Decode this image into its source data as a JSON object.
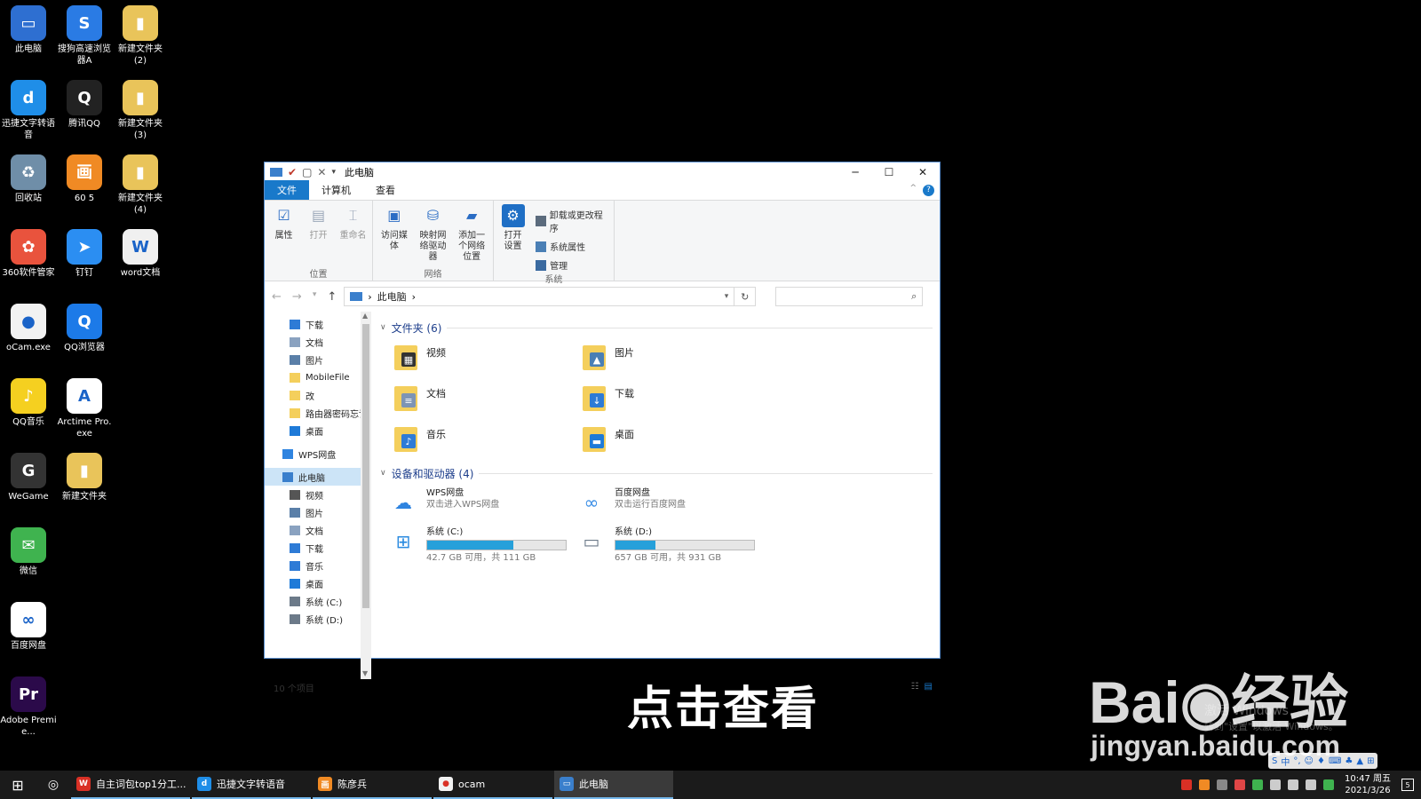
{
  "desktop_icons": [
    {
      "label": "此电脑",
      "color": "#2e6fd1",
      "glyph": "▭",
      "icon": "this-pc-icon"
    },
    {
      "label": "搜狗高速浏览器A",
      "color": "#2a7be4",
      "glyph": "S",
      "icon": "sogou-browser-icon"
    },
    {
      "label": "新建文件夹 (2)",
      "color": "#e9c45a",
      "glyph": "▮",
      "icon": "folder-icon"
    },
    {
      "label": "迅捷文字转语音",
      "color": "#1f8ee8",
      "glyph": "d",
      "icon": "tts-app-icon"
    },
    {
      "label": "腾讯QQ",
      "color": "#222222",
      "glyph": "Q",
      "icon": "qq-icon"
    },
    {
      "label": "新建文件夹 (3)",
      "color": "#e9c45a",
      "glyph": "▮",
      "icon": "folder-icon"
    },
    {
      "label": "回收站",
      "color": "#6f8ea8",
      "glyph": "♻",
      "icon": "recycle-bin-icon"
    },
    {
      "label": "60 5",
      "color": "#f08a24",
      "glyph": "画",
      "icon": "app-60-icon"
    },
    {
      "label": "新建文件夹 (4)",
      "color": "#e9c45a",
      "glyph": "▮",
      "icon": "folder-icon"
    },
    {
      "label": "360软件管家",
      "color": "#e9533d",
      "glyph": "✿",
      "icon": "360-manager-icon"
    },
    {
      "label": "钉钉",
      "color": "#2b8ef2",
      "glyph": "➤",
      "icon": "dingtalk-icon"
    },
    {
      "label": "word文档",
      "color": "#f0f0f0",
      "glyph": "W",
      "icon": "word-doc-icon"
    },
    {
      "label": "oCam.exe",
      "color": "#f2f2f2",
      "glyph": "●",
      "icon": "ocam-icon"
    },
    {
      "label": "QQ浏览器",
      "color": "#1c7ae8",
      "glyph": "Q",
      "icon": "qq-browser-icon"
    },
    {
      "label": "",
      "color": "#000000",
      "glyph": "",
      "icon": "empty-slot"
    },
    {
      "label": "QQ音乐",
      "color": "#f5d020",
      "glyph": "♪",
      "icon": "qq-music-icon"
    },
    {
      "label": "Arctime Pro.exe",
      "color": "#ffffff",
      "glyph": "A",
      "icon": "arctime-icon"
    },
    {
      "label": "",
      "color": "#000000",
      "glyph": "",
      "icon": "empty-slot"
    },
    {
      "label": "WeGame",
      "color": "#333333",
      "glyph": "G",
      "icon": "wegame-icon"
    },
    {
      "label": "新建文件夹",
      "color": "#e9c45a",
      "glyph": "▮",
      "icon": "folder-icon"
    },
    {
      "label": "",
      "color": "#000000",
      "glyph": "",
      "icon": "empty-slot"
    },
    {
      "label": "微信",
      "color": "#3fb34f",
      "glyph": "✉",
      "icon": "wechat-icon"
    },
    {
      "label": "",
      "color": "#000000",
      "glyph": "",
      "icon": "empty-slot"
    },
    {
      "label": "",
      "color": "#000000",
      "glyph": "",
      "icon": "empty-slot"
    },
    {
      "label": "百度网盘",
      "color": "#ffffff",
      "glyph": "∞",
      "icon": "baidu-netdisk-icon"
    },
    {
      "label": "",
      "color": "#000000",
      "glyph": "",
      "icon": "empty-slot"
    },
    {
      "label": "",
      "color": "#000000",
      "glyph": "",
      "icon": "empty-slot"
    },
    {
      "label": "Adobe Premie...",
      "color": "#2b0a4a",
      "glyph": "Pr",
      "icon": "premiere-icon"
    }
  ],
  "window": {
    "title": "此电脑",
    "minimize": "─",
    "maximize": "☐",
    "close": "✕",
    "qa_icons": [
      "✔",
      "▢",
      "✕",
      "▾"
    ]
  },
  "tabs": {
    "file": "文件",
    "computer": "计算机",
    "view": "查看",
    "help": "?",
    "collapse": "^"
  },
  "ribbon": {
    "location": {
      "name": "位置",
      "buttons": [
        {
          "label": "属性",
          "icon": "properties-icon",
          "glyph": "☑",
          "dim": false
        },
        {
          "label": "打开",
          "icon": "open-icon",
          "glyph": "▤",
          "dim": true
        },
        {
          "label": "重命名",
          "icon": "rename-icon",
          "glyph": "⌶",
          "dim": true
        }
      ]
    },
    "network": {
      "name": "网络",
      "buttons": [
        {
          "label": "访问媒体",
          "icon": "access-media-icon",
          "glyph": "▣"
        },
        {
          "label": "映射网络驱动器",
          "icon": "map-drive-icon",
          "glyph": "⛁"
        },
        {
          "label": "添加一个网络位置",
          "icon": "add-network-location-icon",
          "glyph": "▰"
        }
      ]
    },
    "system": {
      "name": "系统",
      "open_settings": "打开设置",
      "items": [
        {
          "label": "卸载或更改程序",
          "icon": "uninstall-icon"
        },
        {
          "label": "系统属性",
          "icon": "system-properties-icon"
        },
        {
          "label": "管理",
          "icon": "manage-icon"
        }
      ]
    }
  },
  "address": {
    "back": "←",
    "forward": "→",
    "recent": "▾",
    "up": "↑",
    "crumb": "此电脑",
    "sep": "›",
    "dropdown": "▾",
    "refresh": "↻",
    "search_icon": "⌕"
  },
  "nav": [
    {
      "label": "下载",
      "icon": "download-icon",
      "color": "#2e7bd6",
      "pinned": true,
      "level": 2
    },
    {
      "label": "文档",
      "icon": "document-icon",
      "color": "#8aa2c0",
      "pinned": true,
      "level": 2
    },
    {
      "label": "图片",
      "icon": "picture-icon",
      "color": "#5a7fa8",
      "pinned": true,
      "level": 2
    },
    {
      "label": "MobileFile",
      "icon": "folder-icon",
      "color": "#f4cf5c",
      "pinned": false,
      "level": 2
    },
    {
      "label": "改",
      "icon": "folder-icon",
      "color": "#f4cf5c",
      "pinned": false,
      "level": 2
    },
    {
      "label": "路由器密码忘记",
      "icon": "folder-icon",
      "color": "#f4cf5c",
      "pinned": false,
      "level": 2
    },
    {
      "label": "桌面",
      "icon": "desktop-folder-icon",
      "color": "#1e7ad8",
      "pinned": false,
      "level": 2
    },
    {
      "label": "WPS网盘",
      "icon": "wps-cloud-icon",
      "color": "#2f84e0",
      "pinned": false,
      "level": 1,
      "gap_before": true
    },
    {
      "label": "此电脑",
      "icon": "this-pc-icon",
      "color": "#3a7fcc",
      "pinned": false,
      "level": 1,
      "selected": true,
      "gap_before": true
    },
    {
      "label": "视频",
      "icon": "video-icon",
      "color": "#555555",
      "pinned": false,
      "level": 2
    },
    {
      "label": "图片",
      "icon": "picture-icon",
      "color": "#5a7fa8",
      "pinned": false,
      "level": 2
    },
    {
      "label": "文档",
      "icon": "document-icon",
      "color": "#8aa2c0",
      "pinned": false,
      "level": 2
    },
    {
      "label": "下载",
      "icon": "download-icon",
      "color": "#2e7bd6",
      "pinned": false,
      "level": 2
    },
    {
      "label": "音乐",
      "icon": "music-icon",
      "color": "#2e7bd6",
      "pinned": false,
      "level": 2
    },
    {
      "label": "桌面",
      "icon": "desktop-folder-icon",
      "color": "#1e7ad8",
      "pinned": false,
      "level": 2
    },
    {
      "label": "系统 (C:)",
      "icon": "drive-c-icon",
      "color": "#6c7a89",
      "pinned": false,
      "level": 2
    },
    {
      "label": "系统 (D:)",
      "icon": "drive-d-icon",
      "color": "#6c7a89",
      "pinned": false,
      "level": 2
    }
  ],
  "folders_section": {
    "title": "文件夹 (6)",
    "items": [
      {
        "name": "视频",
        "icon": "video-folder-icon",
        "overlay": "▦",
        "overlay_color": "#333333"
      },
      {
        "name": "图片",
        "icon": "pictures-folder-icon",
        "overlay": "▲",
        "overlay_color": "#4a7fb5"
      },
      {
        "name": "文档",
        "icon": "documents-folder-icon",
        "overlay": "≡",
        "overlay_color": "#7d94b5"
      },
      {
        "name": "下载",
        "icon": "downloads-folder-icon",
        "overlay": "↓",
        "overlay_color": "#2e7bd6"
      },
      {
        "name": "音乐",
        "icon": "music-folder-icon",
        "overlay": "♪",
        "overlay_color": "#2e7bd6"
      },
      {
        "name": "桌面",
        "icon": "desktop-folder-icon",
        "overlay": "▬",
        "overlay_color": "#1e7ad8"
      }
    ]
  },
  "drives_section": {
    "title": "设备和驱动器 (4)",
    "items": [
      {
        "name": "WPS网盘",
        "sub": "双击进入WPS网盘",
        "icon": "wps-cloud-icon",
        "glyph": "☁",
        "color": "#2f84e0"
      },
      {
        "name": "百度网盘",
        "sub": "双击运行百度网盘",
        "icon": "baidu-netdisk-icon",
        "glyph": "∞",
        "color": "#3a8ee6"
      },
      {
        "name": "系统 (C:)",
        "sub": "42.7 GB 可用，共 111 GB",
        "icon": "drive-c-icon",
        "glyph": "⊞",
        "color": "#2b8be0",
        "used_fraction": 0.62
      },
      {
        "name": "系统 (D:)",
        "sub": "657 GB 可用，共 931 GB",
        "icon": "drive-d-icon",
        "glyph": "▭",
        "color": "#6c7a89",
        "used_fraction": 0.29
      }
    ]
  },
  "status": {
    "count": "10 个项目",
    "view_icons": [
      "☷",
      "▤"
    ]
  },
  "subtitle": "点击查看",
  "watermark": {
    "logo": "Bai◉经验",
    "url": "jingyan.baidu.com",
    "activate1": "激活 Windows",
    "activate2": "转到\"设置\"以激活 Windows。"
  },
  "taskbar": {
    "start": "⊞",
    "cortana": "◎",
    "items": [
      {
        "label": "自主词包top1分工...",
        "icon": "wps-icon",
        "glyph": "W",
        "color": "#d93025",
        "active": false
      },
      {
        "label": "迅捷文字转语音",
        "icon": "tts-app-icon",
        "glyph": "d",
        "color": "#1f8ee8",
        "active": false
      },
      {
        "label": "陈彦兵",
        "icon": "app-60-icon",
        "glyph": "画",
        "color": "#f08a24",
        "active": false
      },
      {
        "label": "ocam",
        "icon": "ocam-icon",
        "glyph": "●",
        "color": "#f2f2f2",
        "active": false
      },
      {
        "label": "此电脑",
        "icon": "this-pc-icon",
        "glyph": "▭",
        "color": "#3a7fcc",
        "active": true
      }
    ],
    "tray_icons": [
      "#d93025",
      "#f08a24",
      "#888888",
      "#e04646",
      "#3fb34f",
      "#cccccc",
      "#cccccc",
      "#cccccc",
      "#3fb34f"
    ],
    "time": "10:47 周五",
    "date": "2021/3/26",
    "notif": "5"
  },
  "ime": {
    "items": [
      "S",
      "中",
      "°,",
      "☺",
      "♦",
      "⌨",
      "♣",
      "▲",
      "⊞"
    ]
  }
}
